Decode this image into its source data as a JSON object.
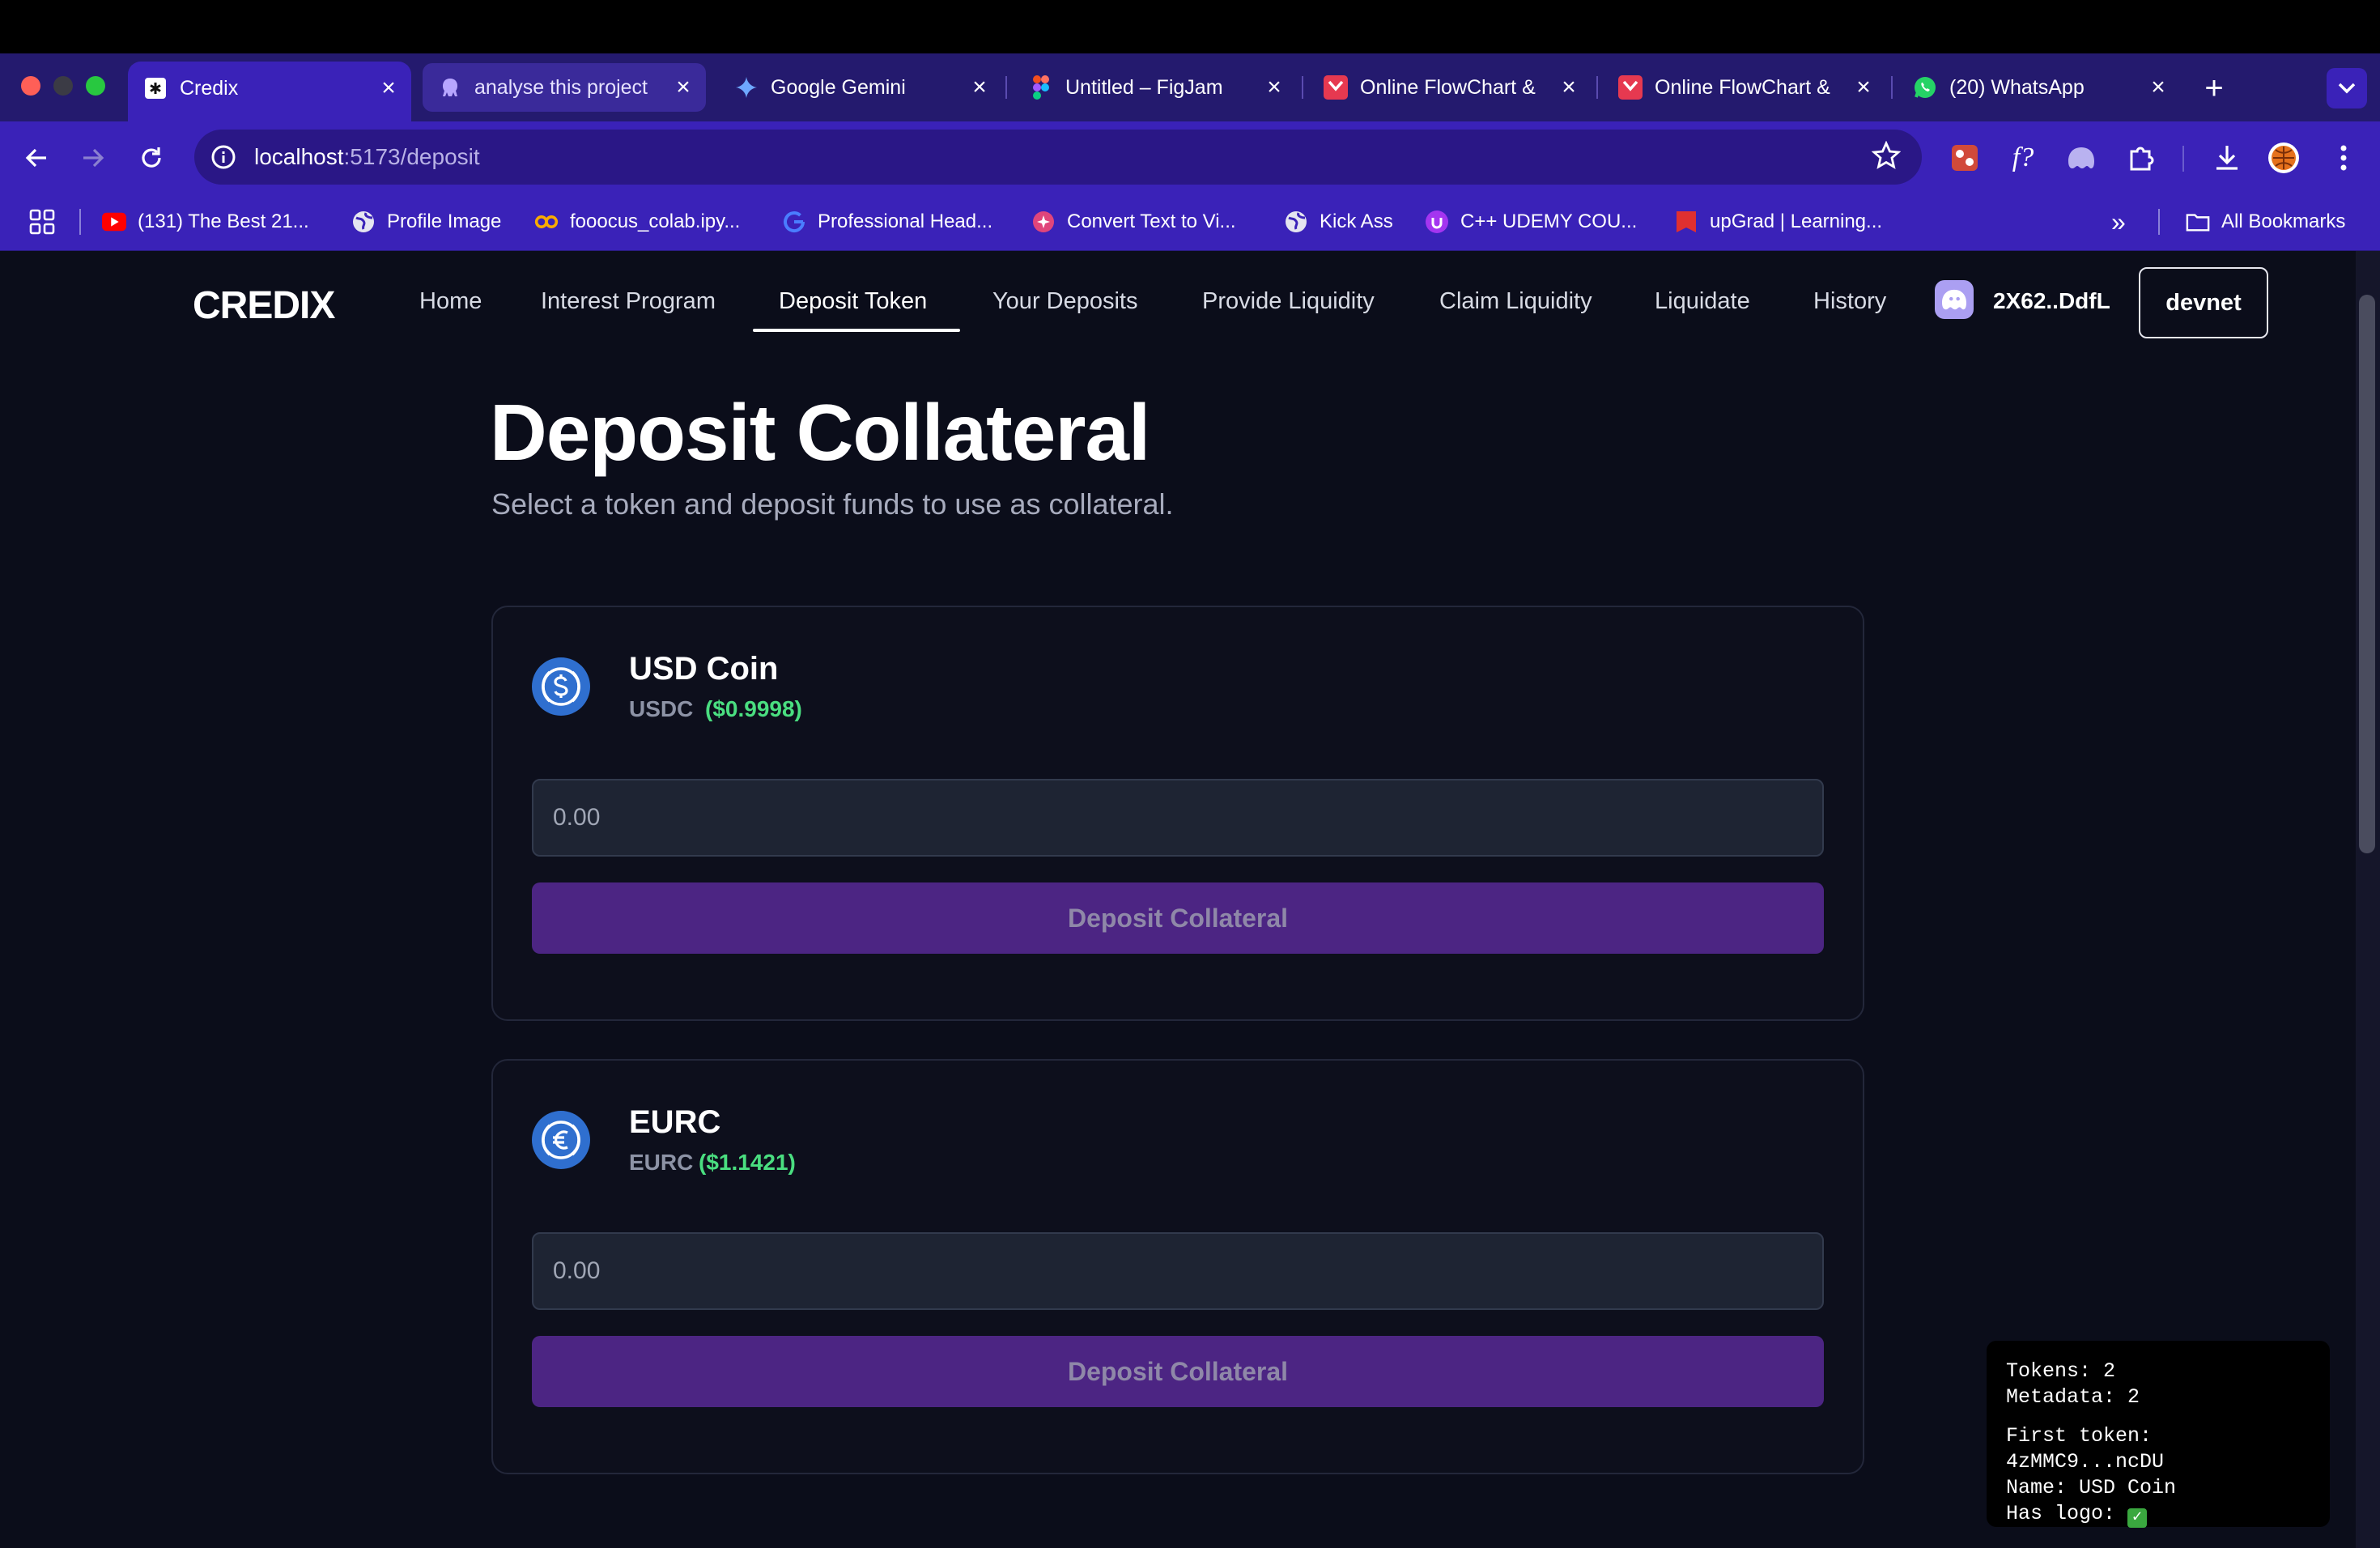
{
  "browser": {
    "tabs": [
      {
        "title": "Credix",
        "icon": "asterisk-icon",
        "active": true
      },
      {
        "title": "analyse this project",
        "icon": "octopus-icon",
        "active": false
      },
      {
        "title": "Google Gemini",
        "icon": "gemini-icon",
        "active": false
      },
      {
        "title": "Untitled – FigJam",
        "icon": "figma-icon",
        "active": false
      },
      {
        "title": "Online FlowChart &",
        "icon": "flowchart-icon",
        "active": false
      },
      {
        "title": "Online FlowChart &",
        "icon": "flowchart-icon",
        "active": false
      },
      {
        "title": "(20) WhatsApp",
        "icon": "whatsapp-icon",
        "active": false
      }
    ],
    "url_host": "localhost",
    "url_path": ":5173/deposit",
    "bookmarks": [
      {
        "label": "(131) The Best 21...",
        "icon": "youtube-icon"
      },
      {
        "label": "Profile Image",
        "icon": "globe-icon"
      },
      {
        "label": "fooocus_colab.ipy...",
        "icon": "colab-icon"
      },
      {
        "label": "Professional Head...",
        "icon": "google-icon"
      },
      {
        "label": "Convert Text to Vi...",
        "icon": "sparkle-icon"
      },
      {
        "label": "Kick Ass",
        "icon": "globe-icon"
      },
      {
        "label": "C++ UDEMY COU...",
        "icon": "udemy-icon"
      },
      {
        "label": "upGrad | Learning...",
        "icon": "upgrad-icon"
      }
    ],
    "all_bookmarks": "All Bookmarks",
    "overflow": "»"
  },
  "app": {
    "brand": "CREDIX",
    "nav": [
      {
        "label": "Home"
      },
      {
        "label": "Interest Program"
      },
      {
        "label": "Deposit Token",
        "active": true
      },
      {
        "label": "Your Deposits"
      },
      {
        "label": "Provide Liquidity"
      },
      {
        "label": "Claim Liquidity"
      },
      {
        "label": "Liquidate"
      },
      {
        "label": "History"
      }
    ],
    "wallet_address": "2X62..DdfL",
    "network": "devnet"
  },
  "page": {
    "title": "Deposit Collateral",
    "subtitle": "Select a token and deposit funds to use as collateral."
  },
  "tokens": [
    {
      "name": "USD Coin",
      "symbol": "USDC",
      "price": "($0.9998)",
      "icon": "dollar-coin-icon",
      "placeholder": "0.00",
      "button": "Deposit Collateral"
    },
    {
      "name": "EURC",
      "symbol": "EURC",
      "price": "($1.1421)",
      "icon": "euro-coin-icon",
      "placeholder": "0.00",
      "button": "Deposit Collateral"
    }
  ],
  "debug": {
    "tokens": "Tokens: 2",
    "metadata": "Metadata: 2",
    "first_token": "First token: 4zMMC9...ncDU",
    "name": "Name: USD Coin",
    "has_logo": "Has logo:"
  },
  "colors": {
    "tab_strip": "#241a6e",
    "toolbar": "#3a22b8",
    "page_bg": "#0b0d1a",
    "button": "#4c2583",
    "price_green": "#4ade80"
  }
}
